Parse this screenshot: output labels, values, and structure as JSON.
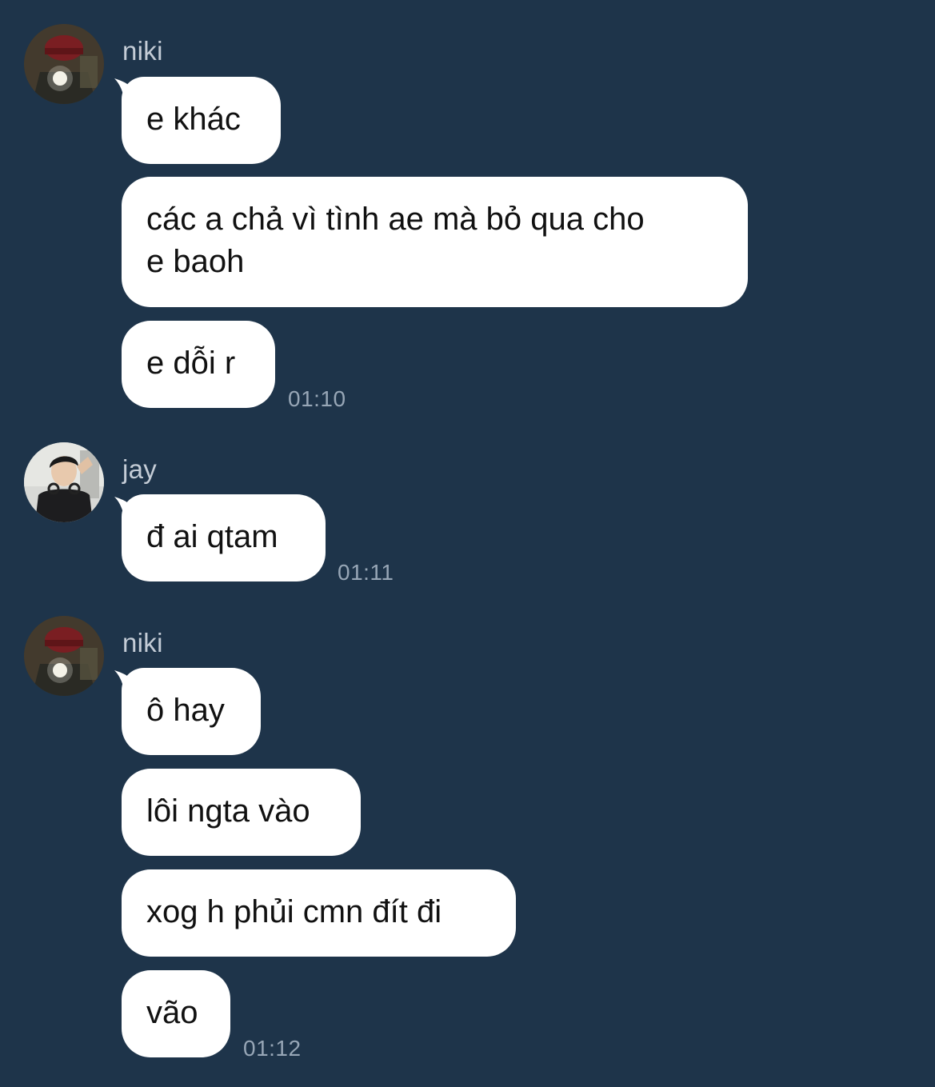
{
  "colors": {
    "background": "#1e344a",
    "bubble": "#ffffff",
    "message_text": "#111111",
    "sender_name": "#c4ccd6",
    "timestamp": "#97a6b6"
  },
  "groups": [
    {
      "sender": "niki",
      "avatar_icon": "user-photo-avatar",
      "messages": [
        "e khác",
        "các a chả vì tình ae mà bỏ qua cho\ne baoh",
        "e dỗi r"
      ],
      "time": "01:10"
    },
    {
      "sender": "jay",
      "avatar_icon": "user-photo-avatar",
      "messages": [
        "đ ai qtam"
      ],
      "time": "01:11"
    },
    {
      "sender": "niki",
      "avatar_icon": "user-photo-avatar",
      "messages": [
        "ô hay",
        "lôi ngta vào",
        "xog h phủi cmn đít đi",
        "vão"
      ],
      "time": "01:12"
    }
  ]
}
